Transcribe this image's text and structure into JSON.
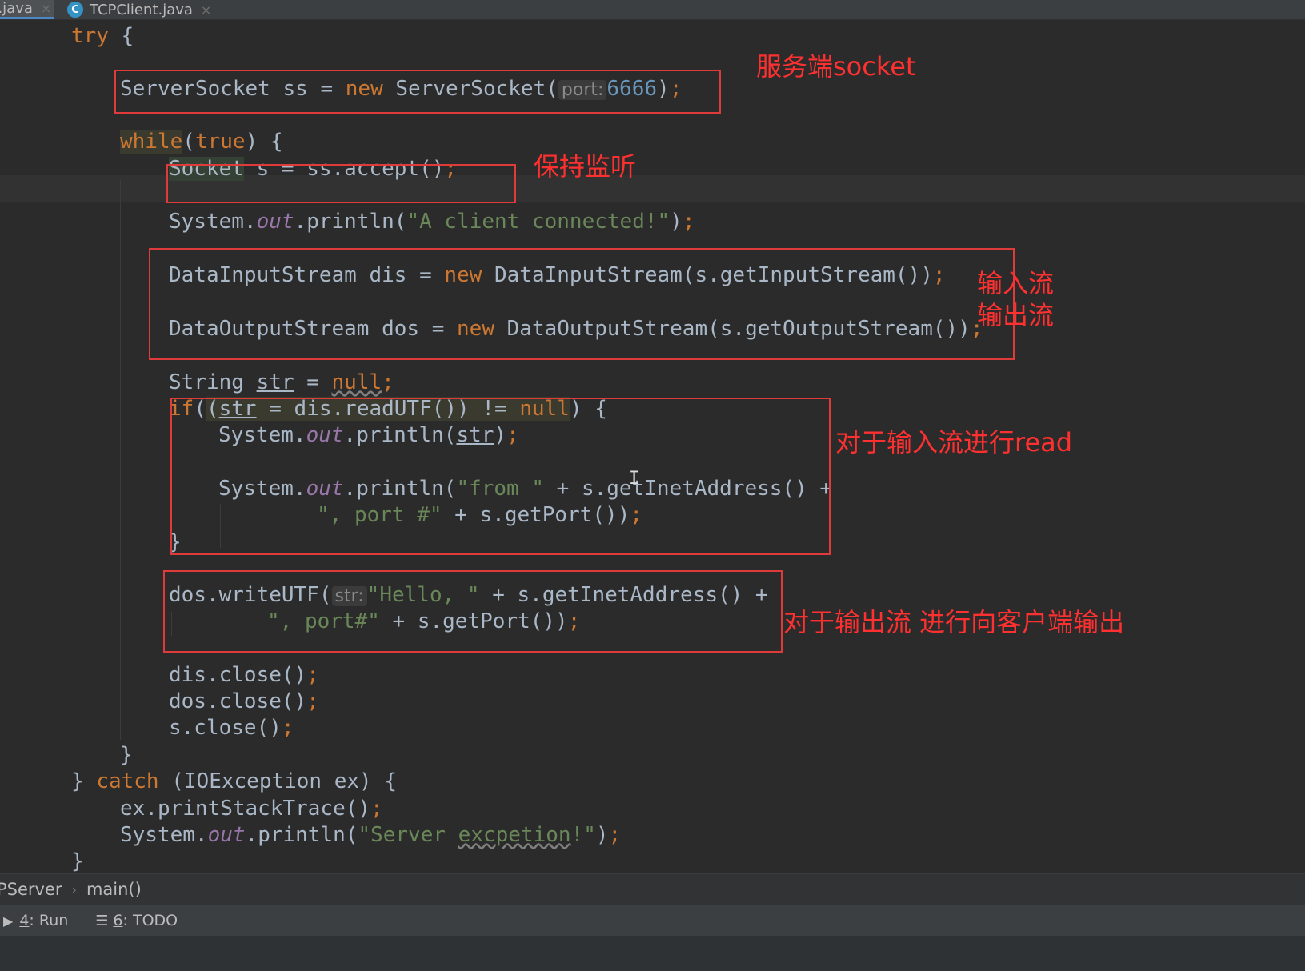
{
  "tabs": [
    {
      "label": "...java",
      "icon": "close-icon",
      "active": true
    },
    {
      "label": "TCPClient.java",
      "icon": "java-class-file-icon",
      "active": false
    }
  ],
  "code": {
    "l1": {
      "a": "try",
      "b": " {"
    },
    "l2": {
      "a": "ServerSocket ss = ",
      "b": "new",
      "c": " ServerSocket(",
      "d": "port:",
      "e": "6666",
      "f": ")",
      "g": ";"
    },
    "l3": {
      "a": "while",
      "b": "(",
      "c": "true",
      "d": ") {"
    },
    "l4": {
      "a": "Socket",
      "b": " s = ss.accept()",
      "c": ";"
    },
    "l5": {
      "a": "System.",
      "b": "out",
      "c": ".println(",
      "d": "\"A client connected!\"",
      "e": ")",
      "f": ";"
    },
    "l6": {
      "a": "DataInputStream dis = ",
      "b": "new",
      "c": " DataInputStream(s.getInputStream())",
      "d": ";"
    },
    "l7": {
      "a": "DataOutputStream dos = ",
      "b": "new",
      "c": " DataOutputStream(s.getOutputStream())",
      "d": ";"
    },
    "l8": {
      "a": "String ",
      "b": "str",
      "c": " = ",
      "d": "null",
      "e": ";"
    },
    "l9": {
      "a": "if",
      "b": "(",
      "c": "(",
      "d": "str",
      "e": " = dis.readUTF()) != ",
      "f": "null",
      "g": ") {"
    },
    "l10": {
      "a": "System.",
      "b": "out",
      "c": ".println(",
      "d": "str",
      "e": ")",
      "f": ";"
    },
    "l11": {
      "a": "System.",
      "b": "out",
      "c": ".println(",
      "d": "\"from \"",
      "e": " + s.getInetAddress() +"
    },
    "l12": {
      "a": "\", port #\"",
      "b": " + s.getPort())",
      "c": ";"
    },
    "l13": {
      "a": "}"
    },
    "l14": {
      "a": "dos.writeUTF(",
      "b": "str:",
      "c": "\"Hello, \"",
      "d": " + s.getInetAddress() +"
    },
    "l15": {
      "a": "\", port#\"",
      "b": " + s.getPort())",
      "c": ";"
    },
    "l16": {
      "a": "dis.close()",
      "b": ";"
    },
    "l17": {
      "a": "dos.close()",
      "b": ";"
    },
    "l18": {
      "a": "s.close()",
      "b": ";"
    },
    "l19": {
      "a": "}"
    },
    "l20": {
      "a": "} ",
      "b": "catch",
      "c": " (IOException ex) {"
    },
    "l21": {
      "a": "ex.printStackTrace()",
      "b": ";"
    },
    "l22": {
      "a": "System.",
      "b": "out",
      "c": ".println(",
      "d": "\"Server ",
      "e": "excpetion",
      "f": "!\"",
      "g": ")",
      "h": ";"
    },
    "l23": {
      "a": "}"
    }
  },
  "annotations": {
    "server_socket": "服务端socket",
    "keep_listening": "保持监听",
    "streams": "输入流\n输出流",
    "read_input": "对于输入流进行read",
    "write_output": "对于输出流 进行向客户端输出"
  },
  "breadcrumb": {
    "class_name": "PServer",
    "method": "main()"
  },
  "statusbar": {
    "run": {
      "num": "4",
      "label": ": Run"
    },
    "todo": {
      "num": "6",
      "label": ": TODO"
    }
  },
  "colors": {
    "background": "#2b2b2b",
    "keyword": "#cc7832",
    "string": "#6a8759",
    "number": "#6897bb",
    "field": "#9876aa",
    "plain": "#a9b7c6",
    "annotation": "#e03b3b"
  }
}
